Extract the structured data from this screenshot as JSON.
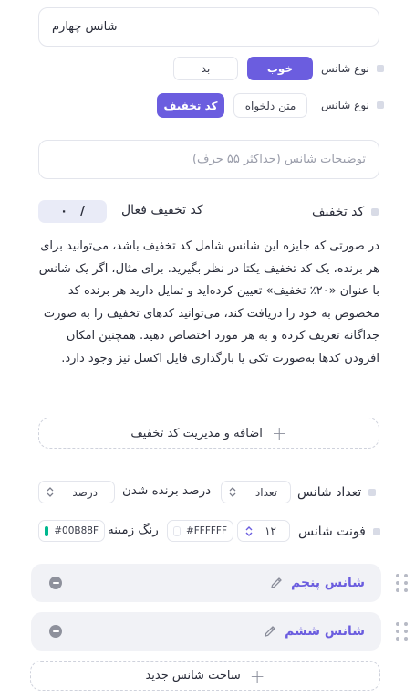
{
  "chance_title_input": {
    "value": "شانس چهارم"
  },
  "chance_type_1": {
    "label": "نوع شانس",
    "options": [
      "خوب",
      "بد"
    ],
    "selected": "خوب"
  },
  "chance_type_2": {
    "label": "نوع شانس",
    "options": [
      "کد تخفیف",
      "متن دلخواه"
    ],
    "selected": "کد تخفیف"
  },
  "description_input": {
    "placeholder": "توضیحات شانس (حداکثر ۵۵ حرف)"
  },
  "discount": {
    "label": "کد تخفیف",
    "active_label": "کد تخفیف فعال",
    "counter": "۰",
    "separator": "/"
  },
  "help_paragraph": "در صورتی که جایزه این شانس شامل کد تخفیف باشد، می‌توانید برای هر برنده، یک کد تخفیف یکتا در نظر بگیرید. برای مثال، اگر یک شانس با عنوان «۲۰٪ تخفیف» تعیین کرده‌اید و تمایل دارید هر برنده کد مخصوص به خود را دریافت کند، می‌توانید کدهای تخفیف را به صورت جداگانه تعریف کرده و به هر مورد اختصاص دهید. همچنین امکان افزودن کدها به‌صورت تکی یا بارگذاری فایل اکسل نیز وجود دارد.",
  "add_discount_button": "اضافه و مدیریت کد تخفیف",
  "chance_count": {
    "label": "تعداد شانس",
    "select_value": "تعداد",
    "win_label": "درصد برنده شدن",
    "win_select": "درصد"
  },
  "font": {
    "label": "فونت شانس",
    "size": "۱۲",
    "text_color": "#FFFFFF",
    "bg_label": "رنگ زمینه",
    "bg_color": "#00B88F"
  },
  "cards": [
    {
      "title": "شانس پنجم"
    },
    {
      "title": "شانس ششم"
    }
  ],
  "new_chance_button": "ساخت شانس جدید",
  "colors": {
    "accent": "#6b5ddf",
    "bg_swatch": "#00B88F"
  }
}
